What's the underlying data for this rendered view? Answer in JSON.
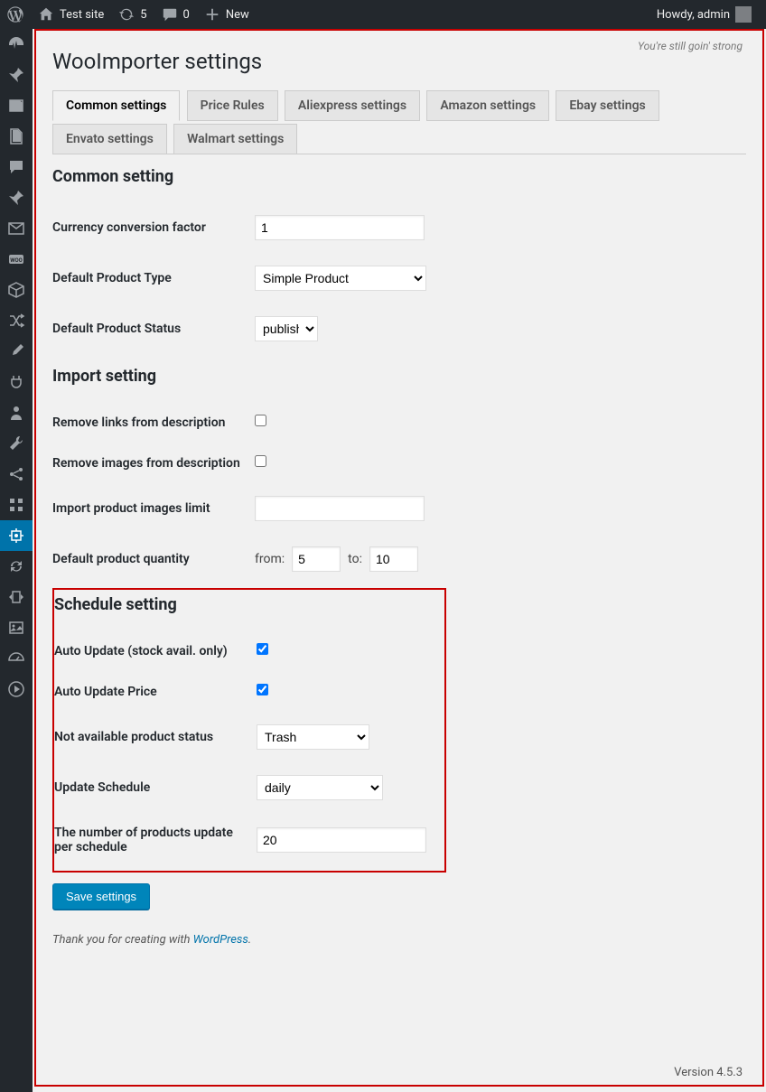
{
  "adminbar": {
    "site_name": "Test site",
    "updates": "5",
    "comments": "0",
    "new": "New",
    "howdy": "Howdy, admin"
  },
  "tagline": "You're still goin' strong",
  "page_title": "WooImporter settings",
  "tabs": {
    "common": "Common settings",
    "price": "Price Rules",
    "ali": "Aliexpress settings",
    "amazon": "Amazon settings",
    "ebay": "Ebay settings",
    "envato": "Envato settings",
    "walmart": "Walmart settings"
  },
  "sections": {
    "common": "Common setting",
    "import": "Import setting",
    "schedule": "Schedule setting"
  },
  "fields": {
    "currency_conv": {
      "label": "Currency conversion factor",
      "value": "1"
    },
    "def_type": {
      "label": "Default Product Type",
      "value": "Simple Product"
    },
    "def_status": {
      "label": "Default Product Status",
      "value": "publish"
    },
    "rm_links": {
      "label": "Remove links from description"
    },
    "rm_images": {
      "label": "Remove images from description"
    },
    "img_limit": {
      "label": "Import product images limit",
      "value": ""
    },
    "def_qty": {
      "label": "Default product quantity",
      "from_label": "from:",
      "from": "5",
      "to_label": "to:",
      "to": "10"
    },
    "auto_update": {
      "label": "Auto Update (stock avail. only)"
    },
    "auto_price": {
      "label": "Auto Update Price"
    },
    "na_status": {
      "label": "Not available product status",
      "value": "Trash"
    },
    "schedule": {
      "label": "Update Schedule",
      "value": "daily"
    },
    "per_sched": {
      "label": "The number of products update per schedule",
      "value": "20"
    }
  },
  "save_label": "Save settings",
  "footer": {
    "thank": "Thank you for creating with ",
    "wp": "WordPress",
    "dot": ".",
    "version": "Version 4.5.3"
  }
}
